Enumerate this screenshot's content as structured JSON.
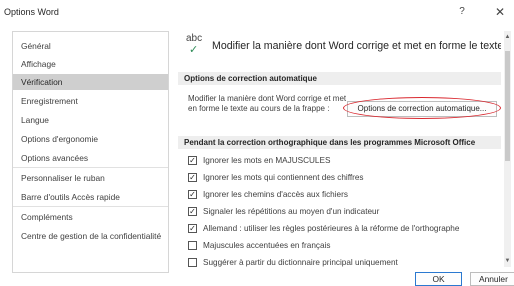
{
  "window": {
    "title": "Options Word",
    "help_glyph": "?",
    "close_glyph": "✕"
  },
  "sidebar": {
    "items": [
      {
        "label": "Général"
      },
      {
        "label": "Affichage"
      },
      {
        "label": "Vérification",
        "selected": true
      },
      {
        "label": "Enregistrement"
      },
      {
        "label": "Langue"
      },
      {
        "label": "Options d'ergonomie"
      },
      {
        "label": "Options avancées"
      },
      {
        "label": "Personnaliser le ruban"
      },
      {
        "label": "Barre d'outils Accès rapide"
      },
      {
        "label": "Compléments"
      },
      {
        "label": "Centre de gestion de la confidentialité"
      }
    ]
  },
  "header": {
    "icon": "abc-check-icon",
    "icon_text": "abc",
    "check_glyph": "✓",
    "text": "Modifier la manière dont Word corrige et met en forme le texte."
  },
  "autocorrect": {
    "section_title": "Options de correction automatique",
    "description": "Modifier la manière dont Word corrige et met en forme le texte au cours de la frappe :",
    "button_label": "Options de correction automatique...",
    "highlight_color": "#d9272e"
  },
  "spelling": {
    "section_title": "Pendant la correction orthographique dans les programmes Microsoft Office",
    "options": [
      {
        "label": "Ignorer les mots en MAJUSCULES",
        "checked": true
      },
      {
        "label": "Ignorer les mots qui contiennent des chiffres",
        "checked": true
      },
      {
        "label": "Ignorer les chemins d'accès aux fichiers",
        "checked": true
      },
      {
        "label": "Signaler les répétitions au moyen d'un indicateur",
        "checked": true
      },
      {
        "label": "Allemand : utiliser les règles postérieures à la réforme de l'orthographe",
        "checked": true
      },
      {
        "label": "Majuscules accentuées en français",
        "checked": false
      },
      {
        "label": "Suggérer à partir du dictionnaire principal uniquement",
        "checked": false
      }
    ],
    "check_glyph": "✓"
  },
  "scrollbar": {
    "up_glyph": "▲",
    "down_glyph": "▼"
  },
  "footer": {
    "ok_label": "OK",
    "cancel_label": "Annuler"
  },
  "colors": {
    "selected_nav": "#cfcfcf",
    "section_bg": "#eeeeee",
    "ok_border": "#2b79d0",
    "check_icon": "#2e8b57"
  }
}
